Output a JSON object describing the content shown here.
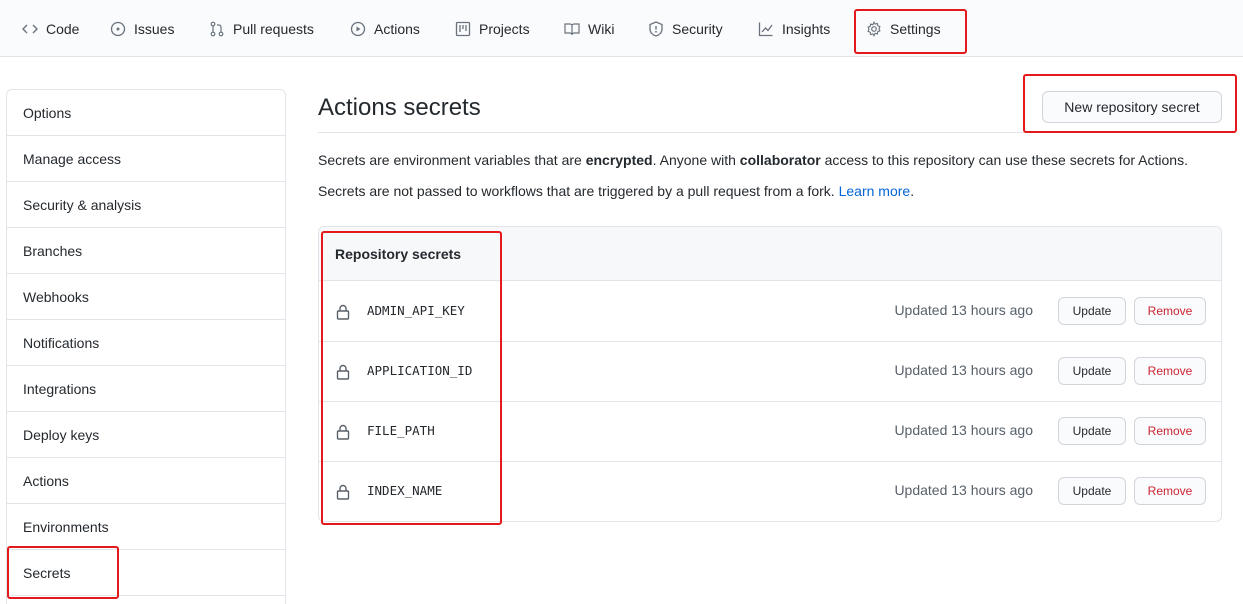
{
  "repo_nav": {
    "tabs": [
      {
        "label": "Code",
        "icon": "code-icon"
      },
      {
        "label": "Issues",
        "icon": "issue-opened-icon"
      },
      {
        "label": "Pull requests",
        "icon": "git-pull-request-icon"
      },
      {
        "label": "Actions",
        "icon": "play-icon"
      },
      {
        "label": "Projects",
        "icon": "project-icon"
      },
      {
        "label": "Wiki",
        "icon": "book-icon"
      },
      {
        "label": "Security",
        "icon": "shield-icon"
      },
      {
        "label": "Insights",
        "icon": "graph-icon"
      },
      {
        "label": "Settings",
        "icon": "gear-icon"
      }
    ],
    "selected": "Settings"
  },
  "sidebar": {
    "items": [
      {
        "label": "Options"
      },
      {
        "label": "Manage access"
      },
      {
        "label": "Security & analysis"
      },
      {
        "label": "Branches"
      },
      {
        "label": "Webhooks"
      },
      {
        "label": "Notifications"
      },
      {
        "label": "Integrations"
      },
      {
        "label": "Deploy keys"
      },
      {
        "label": "Actions"
      },
      {
        "label": "Environments"
      },
      {
        "label": "Secrets"
      }
    ],
    "selected": "Secrets"
  },
  "main": {
    "title": "Actions secrets",
    "new_button_label": "New repository secret",
    "description_1": {
      "before": "Secrets are environment variables that are ",
      "bold1": "encrypted",
      "middle": ". Anyone with ",
      "bold2": "collaborator",
      "after": " access to this repository can use these secrets for Actions."
    },
    "description_2": {
      "text": "Secrets are not passed to workflows that are triggered by a pull request from a fork. ",
      "link": "Learn more",
      "end": "."
    },
    "secrets_box": {
      "header": "Repository secrets",
      "update_label": "Update",
      "remove_label": "Remove",
      "rows": [
        {
          "name": "ADMIN_API_KEY",
          "updated": "Updated 13 hours ago"
        },
        {
          "name": "APPLICATION_ID",
          "updated": "Updated 13 hours ago"
        },
        {
          "name": "FILE_PATH",
          "updated": "Updated 13 hours ago"
        },
        {
          "name": "INDEX_NAME",
          "updated": "Updated 13 hours ago"
        }
      ]
    }
  },
  "colors": {
    "link": "#0366d6",
    "danger": "#cb2431",
    "annotation": "#e3191b"
  }
}
